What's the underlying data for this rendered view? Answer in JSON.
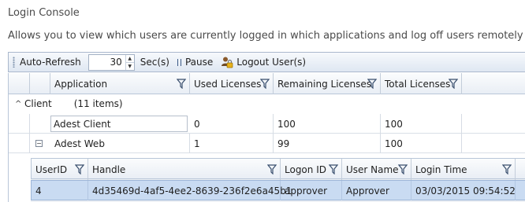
{
  "page": {
    "title": "Login Console",
    "description": "Allows you to view which users are currently logged in which applications and log off users remotely"
  },
  "toolbar": {
    "auto_refresh_label": "Auto-Refresh",
    "refresh_interval": "30",
    "seconds_label": "Sec(s)",
    "pause_label": "Pause",
    "logout_label": "Logout User(s)"
  },
  "grid": {
    "columns": [
      "Application",
      "Used Licenses",
      "Remaining Licenses",
      "Total Licenses"
    ],
    "group": {
      "name": "Client",
      "count_label": "(11 items)"
    },
    "rows": [
      {
        "application": "Adest Client",
        "used": "0",
        "remaining": "100",
        "total": "100"
      },
      {
        "application": "Adest Web",
        "used": "1",
        "remaining": "99",
        "total": "100"
      }
    ]
  },
  "detail": {
    "columns": [
      "UserID",
      "Handle",
      "Logon ID",
      "User Name",
      "Login Time"
    ],
    "rows": [
      {
        "user_id": "4",
        "handle": "4d35469d-4af5-4ee2-8639-236f2e6a45b1",
        "logon_id": "approver",
        "user_name": "Approver",
        "login_time": "03/03/2015 09:54:52"
      }
    ]
  },
  "colors": {
    "accent": "#c9dbf2",
    "toolbar": "#dfe7f2",
    "border": "#b9c6d8"
  }
}
